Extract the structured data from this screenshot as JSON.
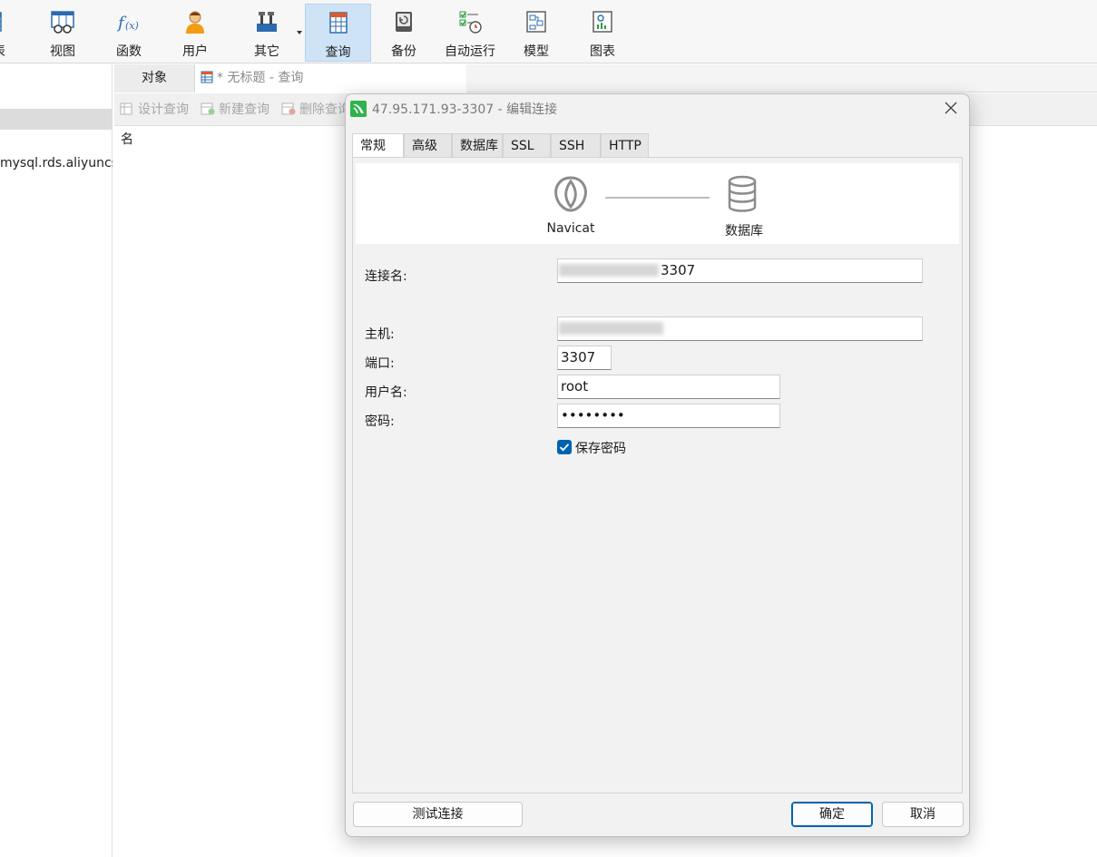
{
  "toolbar": {
    "items": [
      {
        "label": "表",
        "icon": "table-icon"
      },
      {
        "label": "视图",
        "icon": "view-icon"
      },
      {
        "label": "函数",
        "icon": "function-icon"
      },
      {
        "label": "用户",
        "icon": "user-icon"
      },
      {
        "label": "其它",
        "icon": "tools-icon"
      },
      {
        "label": "查询",
        "icon": "query-icon",
        "active": true
      },
      {
        "label": "备份",
        "icon": "backup-icon"
      },
      {
        "label": "自动运行",
        "icon": "automation-icon"
      },
      {
        "label": "模型",
        "icon": "model-icon"
      },
      {
        "label": "图表",
        "icon": "chart-icon"
      }
    ]
  },
  "sidebar": {
    "connection_label": "mysql.rds.aliyuncs"
  },
  "tabs": {
    "objects_label": "对象",
    "query_tab_label": "* 无标题 - 查询"
  },
  "subtoolbar": {
    "design_query": "设计查询",
    "new_query": "新建查询",
    "delete_query": "删除查询"
  },
  "list": {
    "name_header": "名"
  },
  "dialog": {
    "title": "47.95.171.93-3307 - 编辑连接",
    "tabs": [
      "常规",
      "高级",
      "数据库",
      "SSL",
      "SSH",
      "HTTP"
    ],
    "active_tab": "常规",
    "hero": {
      "left_caption": "Navicat",
      "right_caption": "数据库"
    },
    "fields": {
      "connection_name_label": "连接名:",
      "connection_name_value": "3307",
      "host_label": "主机:",
      "host_value": "",
      "port_label": "端口:",
      "port_value": "3307",
      "username_label": "用户名:",
      "username_value": "root",
      "password_label": "密码:",
      "password_value": "••••••••"
    },
    "save_password_label": "保存密码",
    "save_password_checked": true,
    "buttons": {
      "test": "测试连接",
      "ok": "确定",
      "cancel": "取消"
    }
  },
  "colors": {
    "accent": "#0063b1",
    "active_toolbar_bg": "#cfe3f7"
  }
}
